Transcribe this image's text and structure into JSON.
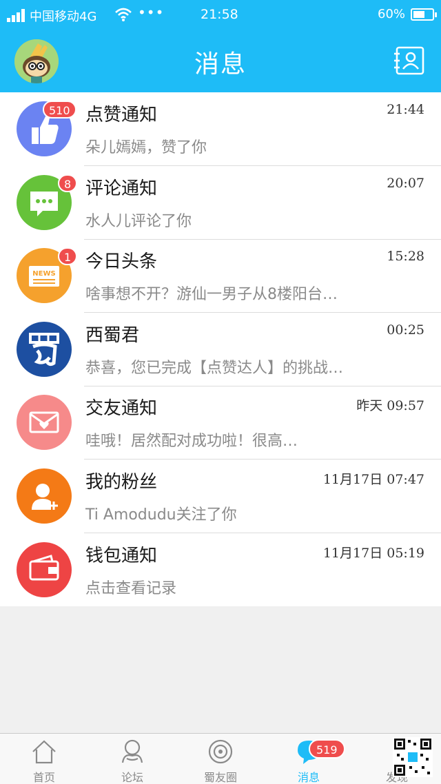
{
  "status_bar": {
    "carrier": "中国移动4G",
    "dots": "•••",
    "time": "21:58",
    "battery_percent": "60%",
    "battery_level": 0.6
  },
  "header": {
    "title": "消息"
  },
  "messages": [
    {
      "title": "点赞通知",
      "preview": "朵儿嫣嫣，赞了你",
      "time": "21:44",
      "badge": "510",
      "icon": "thumbs-up-icon",
      "color": "#6b83f2"
    },
    {
      "title": "评论通知",
      "preview": "水人儿评论了你",
      "time": "20:07",
      "badge": "8",
      "icon": "comment-bubble-icon",
      "color": "#66c23a"
    },
    {
      "title": "今日头条",
      "preview": "啥事想不开？游仙一男子从8楼阳台…",
      "time": "15:28",
      "badge": "1",
      "icon": "news-icon",
      "color": "#f5a12d"
    },
    {
      "title": "西蜀君",
      "preview": "恭喜，您已完成【点赞达人】的挑战…",
      "time": "00:25",
      "badge": "",
      "icon": "xishu-logo-icon",
      "color": "#1d4fa1"
    },
    {
      "title": "交友通知",
      "preview": "哇哦！居然配对成功啦！很高…",
      "time": "昨天 09:57",
      "badge": "",
      "icon": "envelope-heart-icon",
      "color": "#f68a8a"
    },
    {
      "title": "我的粉丝",
      "preview": "Ti Amodudu关注了你",
      "time": "11月17日 07:47",
      "badge": "",
      "icon": "add-user-icon",
      "color": "#f47a16"
    },
    {
      "title": "钱包通知",
      "preview": "点击查看记录",
      "time": "11月17日 05:19",
      "badge": "",
      "icon": "wallet-icon",
      "color": "#ee4444"
    }
  ],
  "tab_bar": {
    "tabs": [
      {
        "label": "首页",
        "icon": "home-icon"
      },
      {
        "label": "论坛",
        "icon": "forum-icon"
      },
      {
        "label": "蜀友圈",
        "icon": "moments-icon"
      },
      {
        "label": "消息",
        "icon": "message-icon",
        "badge": "519"
      },
      {
        "label": "发现",
        "icon": "discover-icon"
      }
    ],
    "active_index": 3,
    "accent": "#1ebcf7"
  }
}
